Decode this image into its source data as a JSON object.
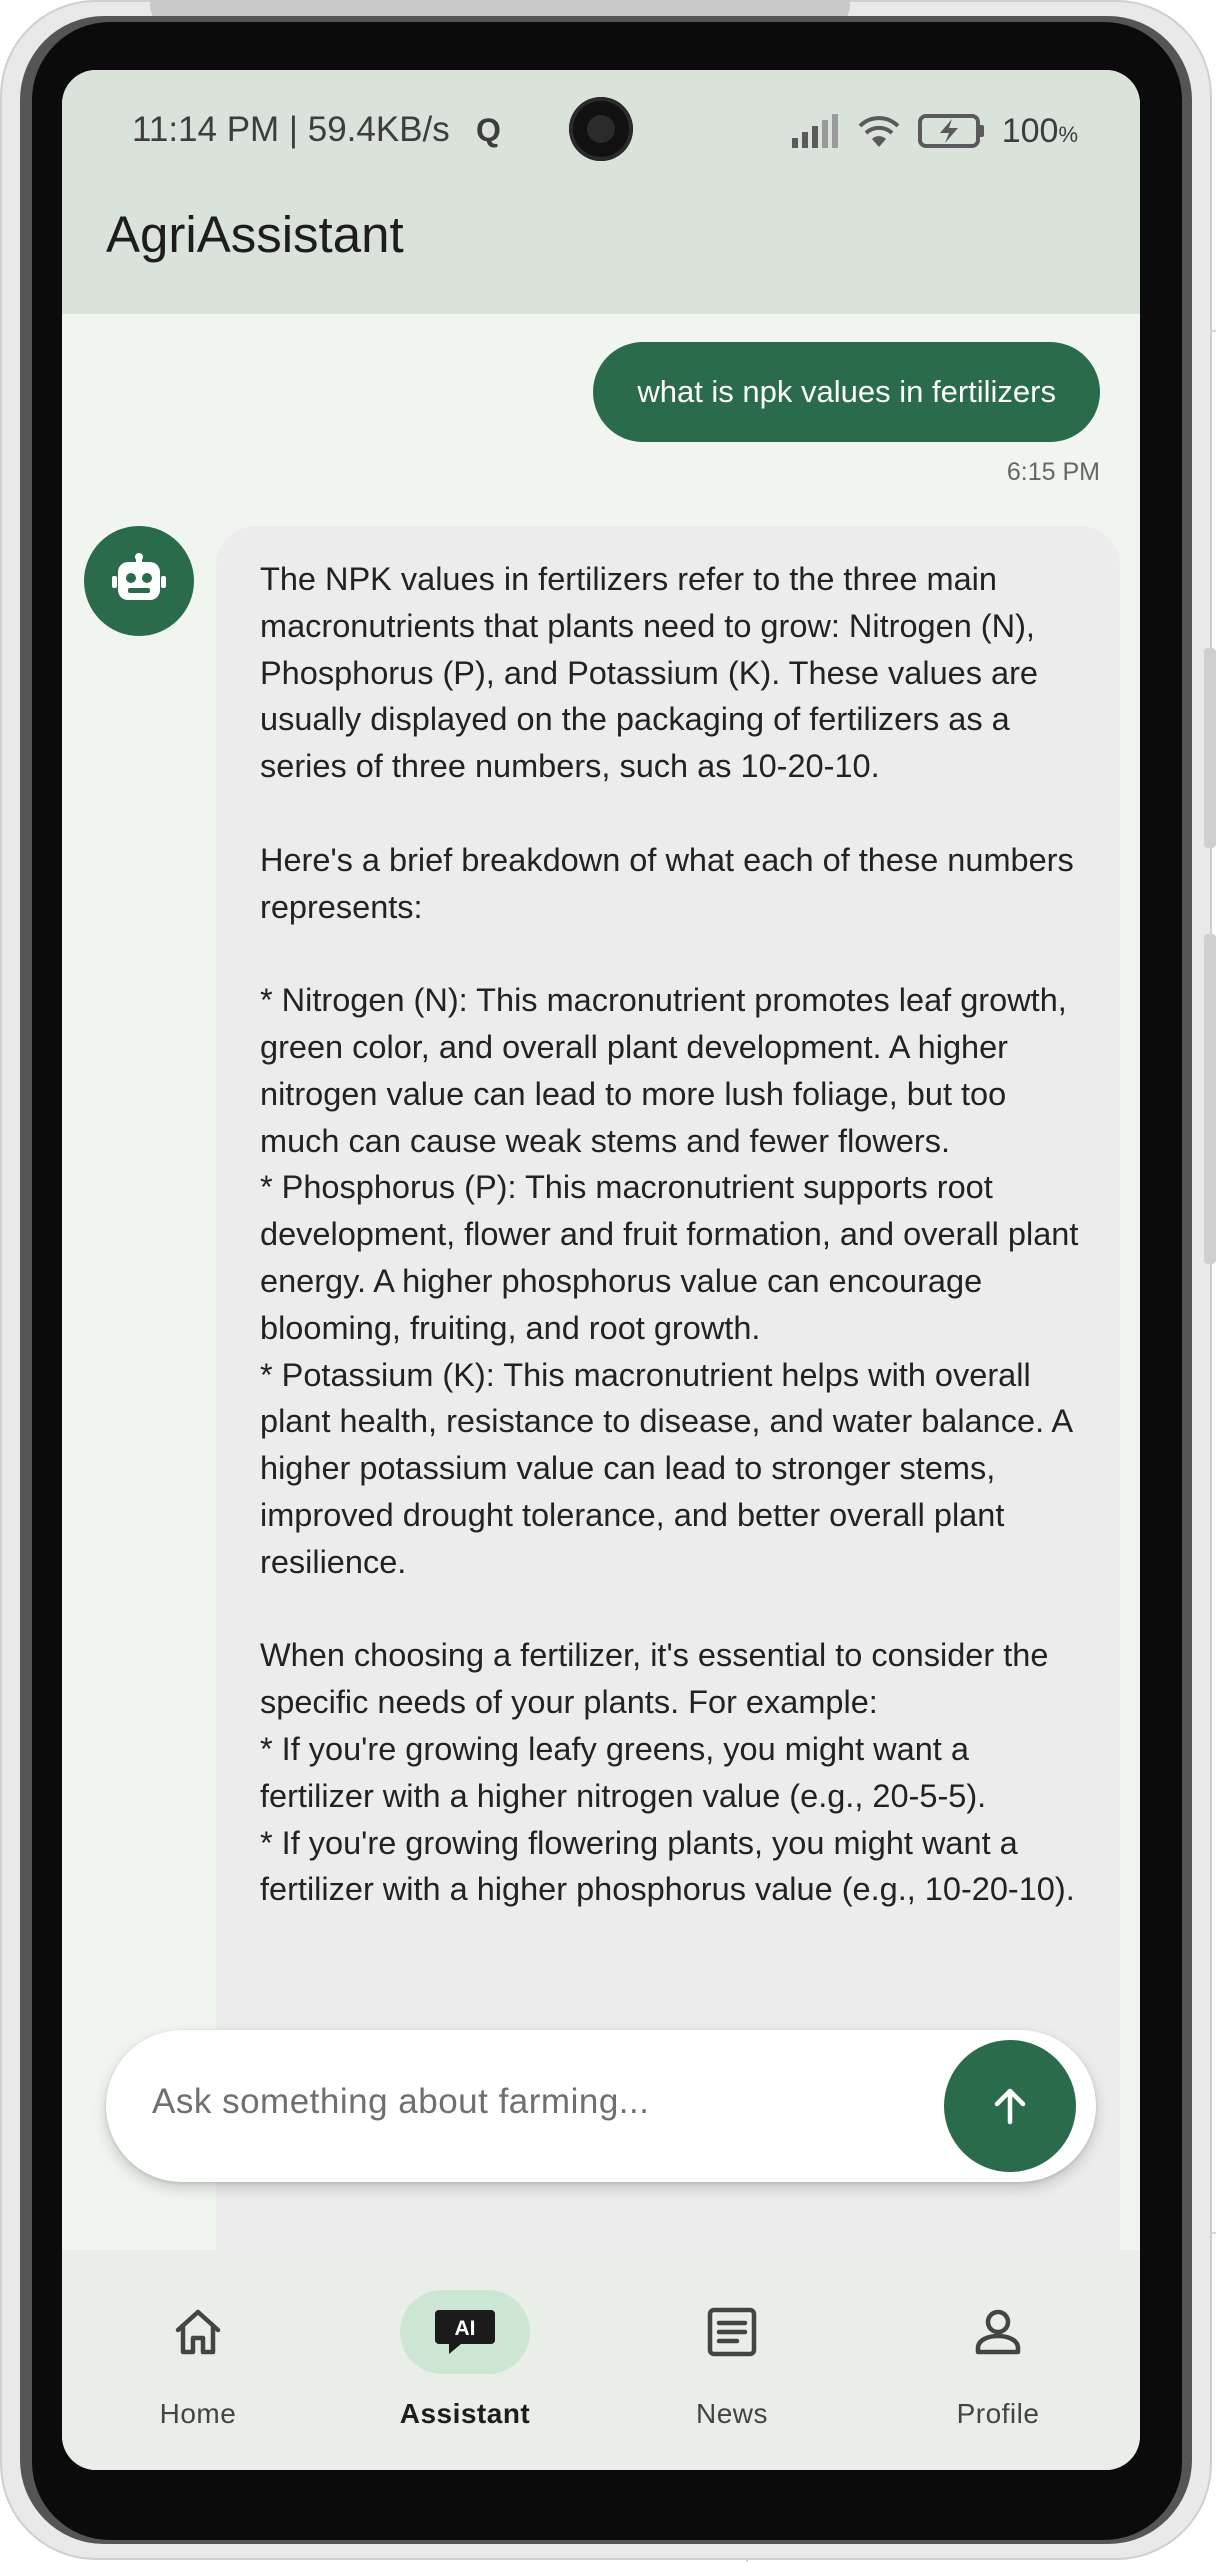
{
  "status_bar": {
    "time_speed": "11:14 PM | 59.4KB/s",
    "net_q": "Q",
    "battery_pct": "100",
    "battery_unit": "%"
  },
  "app_bar": {
    "title": "AgriAssistant"
  },
  "chat": {
    "user_message": "what is npk values in fertilizers",
    "user_time": "6:15 PM",
    "bot_message": "The NPK values in fertilizers refer to the three main macronutrients that plants need to grow: Nitrogen (N), Phosphorus (P), and Potassium (K). These values are usually displayed on the packaging of fertilizers as a series of three numbers, such as 10-20-10.\n\nHere's a brief breakdown of what each of these numbers represents:\n\n* Nitrogen (N): This macronutrient promotes leaf growth, green color, and overall plant development. A higher nitrogen value can lead to more lush foliage, but too much can cause weak stems and fewer flowers.\n* Phosphorus (P): This macronutrient supports root development, flower and fruit formation, and overall plant energy. A higher phosphorus value can encourage blooming, fruiting, and root growth.\n* Potassium (K): This macronutrient helps with overall plant health, resistance to disease, and water balance. A higher potassium value can lead to stronger stems, improved drought tolerance, and better overall plant resilience.\n\nWhen choosing a fertilizer, it's essential to consider the specific needs of your plants. For example:\n* If you're growing leafy greens, you might want a fertilizer with a higher nitrogen value (e.g., 20-5-5).\n* If you're growing flowering plants, you might want a fertilizer with a higher phosphorus value (e.g., 10-20-10)."
  },
  "input": {
    "placeholder": "Ask something about farming..."
  },
  "nav": {
    "items": [
      {
        "label": "Home",
        "icon": "home-icon"
      },
      {
        "label": "Assistant",
        "icon": "ai-chat-icon",
        "badge": "AI"
      },
      {
        "label": "News",
        "icon": "article-icon"
      },
      {
        "label": "Profile",
        "icon": "person-icon"
      }
    ],
    "active_index": 1
  },
  "colors": {
    "primary": "#2a6b4b",
    "app_bar_bg": "#d9e3da",
    "screen_bg": "#f1f5ef",
    "bot_bubble": "#ececec",
    "nav_bg": "#e9eee8",
    "nav_active_pill": "#cde6d3"
  }
}
